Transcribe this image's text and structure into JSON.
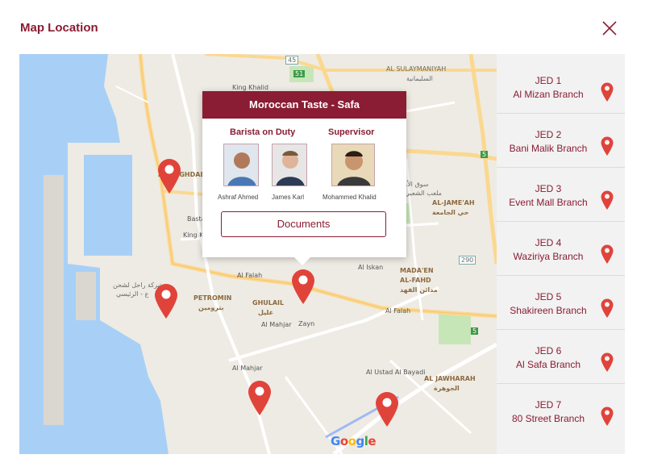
{
  "header": {
    "title": "Map Location",
    "close_icon": "close-icon"
  },
  "colors": {
    "accent": "#8a1c33",
    "pin": "#e0433a",
    "water": "#a8d0f6",
    "panel": "#f2f2f2"
  },
  "popup": {
    "title": "Moroccan Taste - Safa",
    "barista_label": "Barista on Duty",
    "supervisor_label": "Supervisor",
    "people": [
      {
        "name": "Ashraf Ahmed"
      },
      {
        "name": "James Karl"
      },
      {
        "name": "Mohammed Khalid"
      }
    ],
    "documents_label": "Documents"
  },
  "map": {
    "labels": {
      "al_sulaymaniyah": "AL SULAYMANIYAH",
      "al_sulaymaniyah_ar": "السليمانية",
      "al_jameah": "AL-JAME'AH",
      "al_jameah_ar": "حي الجامعة",
      "madaen_1": "MADA'EN",
      "madaen_2": "AL-FAHD",
      "madaen_ar": "مدائن الفهد",
      "petromin": "PETROMIN",
      "petromin_ar": "بترومين",
      "ghulail": "GHULAIL",
      "ghulail_ar": "غليل",
      "al_jawharah": "AL JAWHARAH",
      "al_jawharah_ar": "الجوهرة",
      "al_falah_1": "Al Falah",
      "al_falah_2": "Al Falah",
      "al_mahjar_1": "Al Mahjar",
      "al_mahjar_2": "Al Mahjar",
      "zayn": "Zayn",
      "al_iskan": "Al Iskan",
      "al_ustad": "Al Ustad Al Bayadi",
      "king_khalid": "King Khalid",
      "basta": "Basta",
      "baghdadia": "AL BAGHDADIA",
      "king": "King Kh",
      "port_ar_1": "شركة راحل لشحن",
      "port_ar_2": "ع - الرئيسي",
      "souq_ar": "سوق الأمير",
      "stadium_ar": "ملعب الشعبي",
      "road_45": "45",
      "road_51": "51",
      "road_290": "290",
      "road_5": "5",
      "road_5b": "5"
    },
    "google": [
      "G",
      "o",
      "o",
      "g",
      "l",
      "e"
    ],
    "google_colors": [
      "#4285f4",
      "#ea4335",
      "#fbbc05",
      "#4285f4",
      "#34a853",
      "#ea4335"
    ]
  },
  "branches": [
    {
      "code": "JED 1",
      "name": "Al Mizan Branch"
    },
    {
      "code": "JED 2",
      "name": "Bani Malik Branch"
    },
    {
      "code": "JED 3",
      "name": "Event Mall Branch"
    },
    {
      "code": "JED 4",
      "name": "Waziriya Branch"
    },
    {
      "code": "JED 5",
      "name": "Shakireen Branch"
    },
    {
      "code": "JED 6",
      "name": "Al Safa Branch"
    },
    {
      "code": "JED 7",
      "name": "80 Street Branch"
    }
  ]
}
